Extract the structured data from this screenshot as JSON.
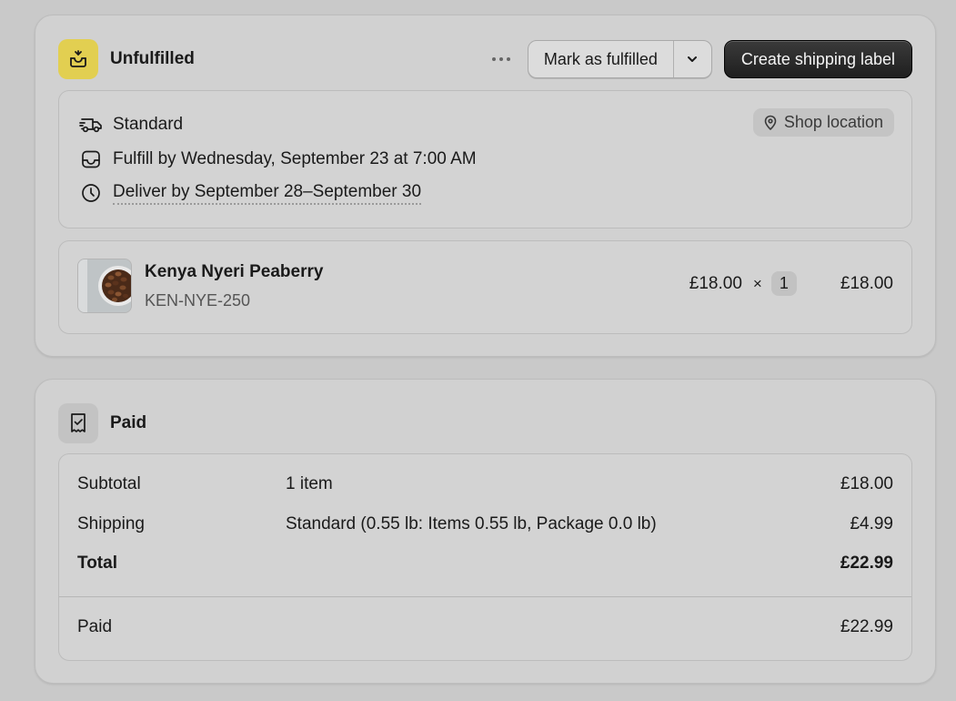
{
  "fulfillment": {
    "status_title": "Unfulfilled",
    "mark_fulfilled_label": "Mark as fulfilled",
    "create_label_button": "Create shipping label",
    "shipping_method": "Standard",
    "fulfill_by": "Fulfill by Wednesday, September 23 at 7:00 AM",
    "deliver_by": "Deliver by September 28–September 30",
    "location_badge": "Shop location",
    "item": {
      "name": "Kenya Nyeri Peaberry",
      "sku": "KEN-NYE-250",
      "unit_price": "£18.00",
      "times": "×",
      "quantity": "1",
      "line_total": "£18.00"
    }
  },
  "payment": {
    "status_title": "Paid",
    "rows": [
      {
        "label": "Subtotal",
        "desc": "1 item",
        "amount": "£18.00"
      },
      {
        "label": "Shipping",
        "desc": "Standard (0.55 lb: Items 0.55 lb, Package 0.0 lb)",
        "amount": "£4.99"
      },
      {
        "label": "Total",
        "desc": "",
        "amount": "£22.99"
      }
    ],
    "paid_row": {
      "label": "Paid",
      "amount": "£22.99"
    }
  },
  "colors": {
    "unfulfilled_badge": "#e2cf51",
    "primary_button": "#262626"
  },
  "icons": [
    "unfulfilled-box-icon",
    "more-options-icon",
    "chevron-down-icon",
    "truck-icon",
    "inbox-icon",
    "clock-icon",
    "location-pin-icon",
    "receipt-check-icon"
  ]
}
